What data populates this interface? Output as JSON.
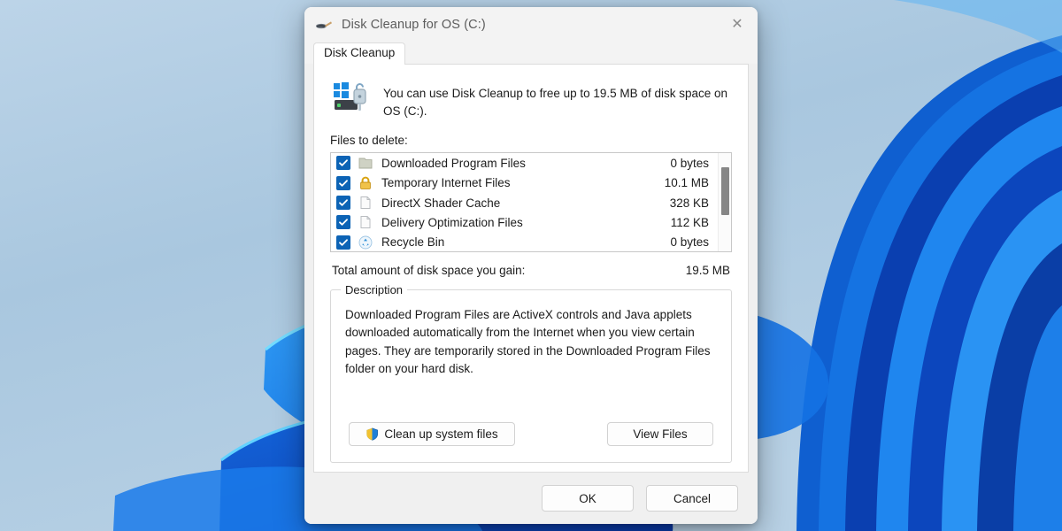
{
  "desktop": {
    "wallpaper_name": "windows-11-bloom-wallpaper",
    "colors": {
      "sky_top": "#b9d2e6",
      "sky_bottom": "#b4cfe4",
      "petal_light": "#41a6f5",
      "petal_mid": "#1a7fe8",
      "petal_deep": "#0b4fc4",
      "petal_darkest": "#08329a",
      "edge_highlight": "#6fd6ff"
    }
  },
  "dialog": {
    "title": "Disk Cleanup for OS (C:)",
    "title_icon": "disk-cleanup-brush-icon",
    "close_label": "✕",
    "tabs": [
      {
        "label": "Disk Cleanup",
        "selected": true
      }
    ],
    "header": {
      "icon": "disk-drive-cleanup-icon",
      "text": "You can use Disk Cleanup to free up to 19.5 MB of disk space on OS (C:)."
    },
    "files_label": "Files to delete:",
    "file_list": [
      {
        "name": "Downloaded Program Files",
        "size": "0 bytes",
        "checked": true,
        "icon": "folder-icon"
      },
      {
        "name": "Temporary Internet Files",
        "size": "10.1 MB",
        "checked": true,
        "icon": "padlock-icon"
      },
      {
        "name": "DirectX Shader Cache",
        "size": "328 KB",
        "checked": true,
        "icon": "page-icon"
      },
      {
        "name": "Delivery Optimization Files",
        "size": "112 KB",
        "checked": true,
        "icon": "page-icon"
      },
      {
        "name": "Recycle Bin",
        "size": "0 bytes",
        "checked": true,
        "icon": "recycle-bin-icon"
      }
    ],
    "scrollbar": {
      "name": "file-list-scrollbar"
    },
    "total": {
      "label": "Total amount of disk space you gain:",
      "value": "19.5 MB"
    },
    "description": {
      "legend": "Description",
      "text": "Downloaded Program Files are ActiveX controls and Java applets downloaded automatically from the Internet when you view certain pages. They are temporarily stored in the Downloaded Program Files folder on your hard disk."
    },
    "buttons": {
      "clean_system_files": "Clean up system files",
      "clean_system_files_icon": "uac-shield-icon",
      "view_files": "View Files",
      "ok": "OK",
      "cancel": "Cancel"
    },
    "accent_color": "#0c63b5"
  }
}
